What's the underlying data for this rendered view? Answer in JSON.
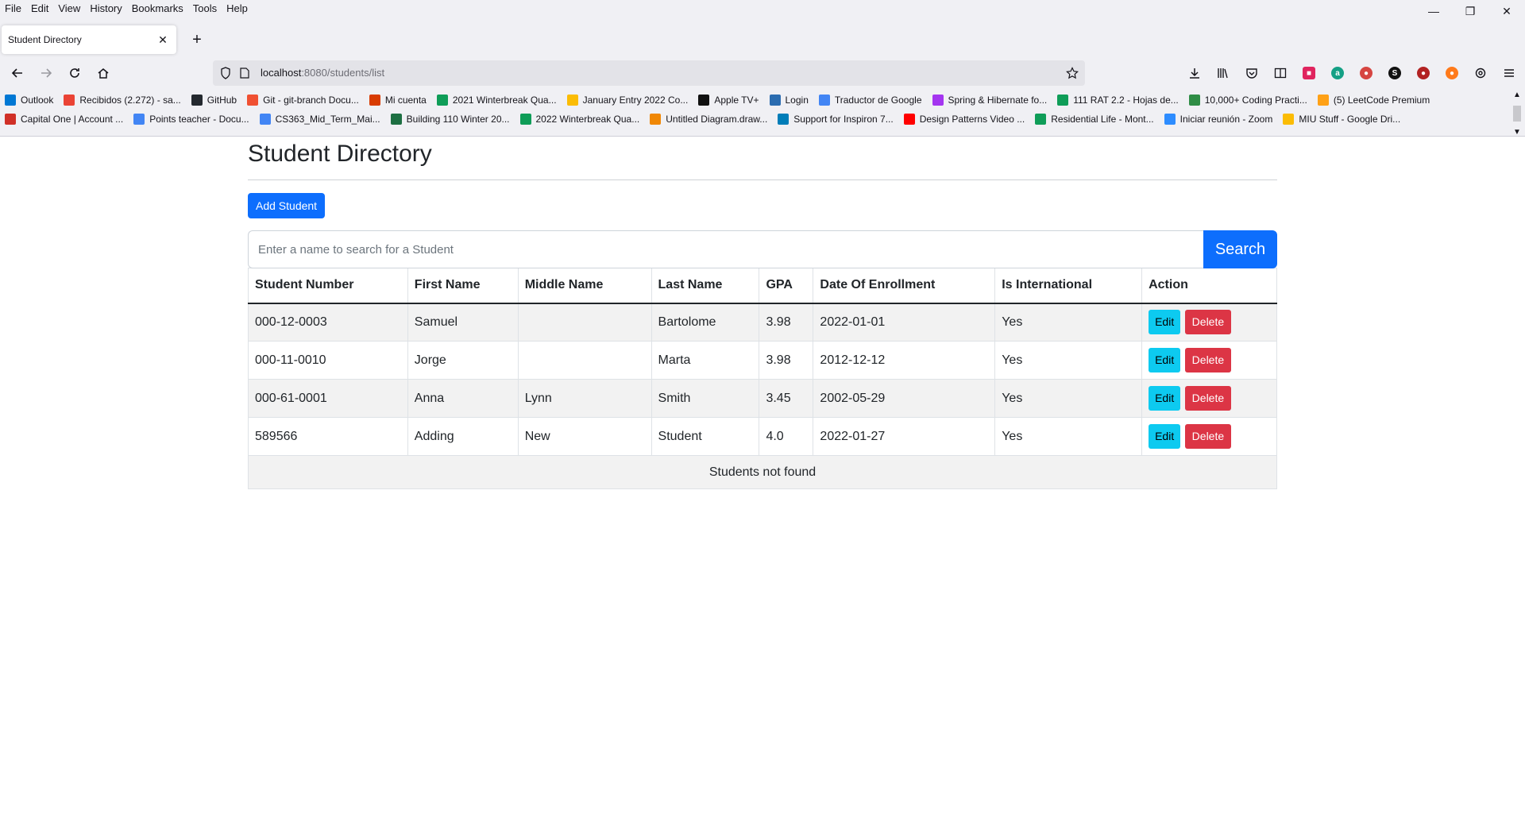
{
  "browser": {
    "menu": [
      "File",
      "Edit",
      "View",
      "History",
      "Bookmarks",
      "Tools",
      "Help"
    ],
    "tab_title": "Student Directory",
    "url_host": "localhost",
    "url_path": ":8080/students/list",
    "bookmarks_row1": [
      {
        "label": "Outlook",
        "color": "#0078d4"
      },
      {
        "label": "Recibidos (2.272) - sa...",
        "color": "#ea4335"
      },
      {
        "label": "GitHub",
        "color": "#24292f"
      },
      {
        "label": "Git - git-branch Docu...",
        "color": "#f05032"
      },
      {
        "label": "Mi cuenta",
        "color": "#d83b01"
      },
      {
        "label": "2021 Winterbreak Qua...",
        "color": "#0f9d58"
      },
      {
        "label": "January Entry 2022 Co...",
        "color": "#fbbc04"
      },
      {
        "label": "Apple TV+",
        "color": "#111111"
      },
      {
        "label": "Login",
        "color": "#2b6cb0"
      },
      {
        "label": "Traductor de Google",
        "color": "#4285f4"
      },
      {
        "label": "Spring & Hibernate fo...",
        "color": "#a435f0"
      },
      {
        "label": "111 RAT 2.2 - Hojas de...",
        "color": "#0f9d58"
      },
      {
        "label": "10,000+ Coding Practi...",
        "color": "#2f8d46"
      },
      {
        "label": "(5) LeetCode Premium",
        "color": "#ffa116"
      }
    ],
    "bookmarks_row2": [
      {
        "label": "Capital One | Account ...",
        "color": "#d03027"
      },
      {
        "label": "Points teacher - Docu...",
        "color": "#4285f4"
      },
      {
        "label": "CS363_Mid_Term_Mai...",
        "color": "#4285f4"
      },
      {
        "label": "Building 110 Winter 20...",
        "color": "#1d6f42"
      },
      {
        "label": "2022 Winterbreak Qua...",
        "color": "#0f9d58"
      },
      {
        "label": "Untitled Diagram.draw...",
        "color": "#f08705"
      },
      {
        "label": "Support for Inspiron 7...",
        "color": "#007db8"
      },
      {
        "label": "Design Patterns Video ...",
        "color": "#ff0000"
      },
      {
        "label": "Residential Life - Mont...",
        "color": "#0f9d58"
      },
      {
        "label": "Iniciar reunión - Zoom",
        "color": "#2d8cff"
      },
      {
        "label": "MIU Stuff - Google Dri...",
        "color": "#fbbc04"
      }
    ]
  },
  "page": {
    "title": "Student Directory",
    "add_button": "Add Student",
    "search_placeholder": "Enter a name to search for a Student",
    "search_button": "Search",
    "columns": [
      "Student Number",
      "First Name",
      "Middle Name",
      "Last Name",
      "GPA",
      "Date Of Enrollment",
      "Is International",
      "Action"
    ],
    "rows": [
      {
        "number": "000-12-0003",
        "first": "Samuel",
        "middle": "",
        "last": "Bartolome",
        "gpa": "3.98",
        "date": "2022-01-01",
        "intl": "Yes"
      },
      {
        "number": "000-11-0010",
        "first": "Jorge",
        "middle": "",
        "last": "Marta",
        "gpa": "3.98",
        "date": "2012-12-12",
        "intl": "Yes"
      },
      {
        "number": "000-61-0001",
        "first": "Anna",
        "middle": "Lynn",
        "last": "Smith",
        "gpa": "3.45",
        "date": "2002-05-29",
        "intl": "Yes"
      },
      {
        "number": "589566",
        "first": "Adding",
        "middle": "New",
        "last": "Student",
        "gpa": "4.0",
        "date": "2022-01-27",
        "intl": "Yes"
      }
    ],
    "edit_label": "Edit",
    "delete_label": "Delete",
    "empty_message": "Students not found"
  }
}
